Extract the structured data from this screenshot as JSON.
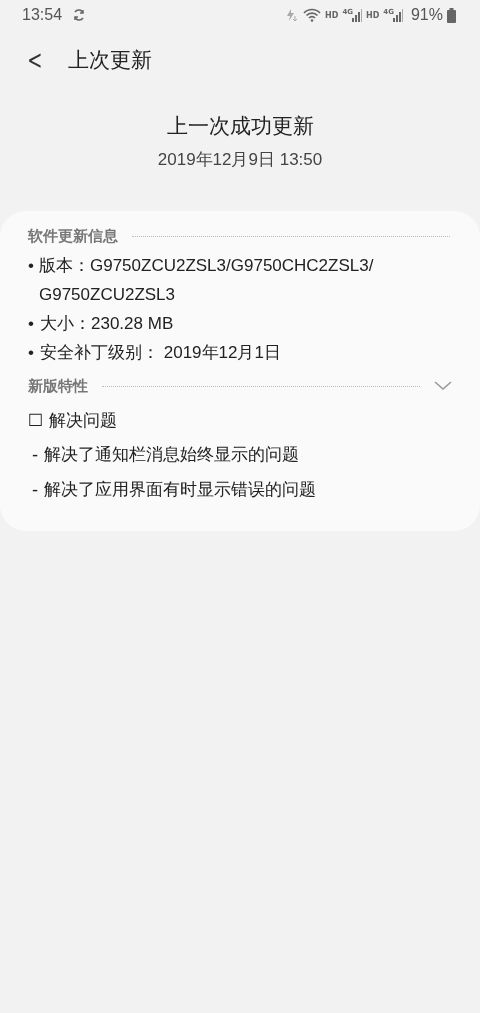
{
  "status_bar": {
    "time": "13:54",
    "networks": [
      {
        "hd": "HD",
        "gen": "4G"
      },
      {
        "hd": "HD",
        "gen": "4G"
      }
    ],
    "battery": "91%"
  },
  "header": {
    "back": "<",
    "title": "上次更新"
  },
  "summary": {
    "heading": "上一次成功更新",
    "date": "2019年12月9日 13:50"
  },
  "card": {
    "sections": [
      {
        "title": "软件更新信息",
        "expandable": false,
        "lines": [
          {
            "kind": "bullet",
            "mark": "•",
            "text": "版本：G9750ZCU2ZSL3/G9750CHC2ZSL3/ G9750ZCU2ZSL3"
          },
          {
            "kind": "bullet",
            "mark": "•",
            "text": "大小：230.28 MB"
          },
          {
            "kind": "bullet",
            "mark": "•",
            "text": "安全补丁级别： 2019年12月1日"
          }
        ]
      },
      {
        "title": "新版特性",
        "expandable": true,
        "lines": [
          {
            "kind": "plain",
            "text": "☐ 解决问题"
          },
          {
            "kind": "dash",
            "text": "- 解决了通知栏消息始终显示的问题"
          },
          {
            "kind": "dash",
            "text": "- 解决了应用界面有时显示错误的问题"
          }
        ]
      }
    ]
  }
}
